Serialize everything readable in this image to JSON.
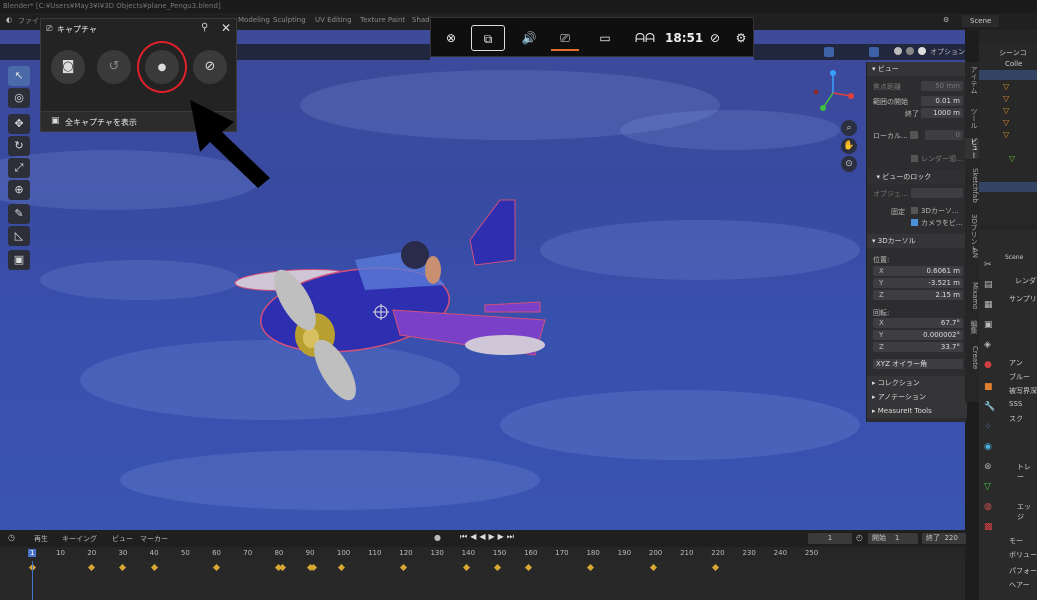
{
  "window": {
    "title": "Blender* [C:¥Users¥May3¥I¥3D Objects¥plane_Pengu3.blend]"
  },
  "topbar": {
    "file_menu": "ファイ",
    "workspaces": [
      "Modeling",
      "Sculpting",
      "UV Editing",
      "Texture Paint",
      "Shadi"
    ],
    "scene_label": "Scene",
    "options_label": "オプション"
  },
  "capture_widget": {
    "title": "キャプチャ",
    "show_all_label": "全キャプチャを表示",
    "screenshot_icon": "camera-icon",
    "record_last_icon": "history-icon",
    "record_icon": "record-dot-icon",
    "mic_icon": "mic-off-icon"
  },
  "gamebar": {
    "time": "18:51",
    "icons": [
      "xbox-icon",
      "widget-icon",
      "audio-icon",
      "capture-icon",
      "performance-icon",
      "social-icon",
      "mouse-icon",
      "settings-icon"
    ]
  },
  "npanel": {
    "view_header": "ビュー",
    "focal_label": "焦点距離",
    "focal_value": "50 mm",
    "clip_start_label": "範囲の開始",
    "clip_start_value": "0.01 m",
    "clip_end_label": "終了",
    "clip_end_value": "1000 m",
    "local_label": "ローカル...",
    "local_value": "0",
    "render_label": "レンダー領...",
    "view_lock_header": "ビューのロック",
    "object_label": "オブジェ...",
    "lock_label": "固定",
    "lock_cursor": "3Dカーソ...",
    "lock_camera": "カメラをビ...",
    "cursor_header": "3Dカーソル",
    "location_label": "位置:",
    "x_label": "X",
    "x_value": "0.6061 m",
    "y_label": "Y",
    "y_value": "-3.521 m",
    "z_label": "Z",
    "z_value": "2.15 m",
    "rotation_label": "回転:",
    "rx_value": "67.7°",
    "ry_value": "0.000002°",
    "rz_value": "33.7°",
    "rot_mode": "XYZ オイラー角",
    "collection_header": "コレクション",
    "annotation_header": "アノテーション",
    "measureit_header": "MeasureIt Tools"
  },
  "vtabs": [
    "アイテム",
    "ツール",
    "ビュー",
    "Sketchfab",
    "3Dプリント",
    "AN",
    "Mixamo",
    "編集",
    "Create"
  ],
  "outliner": {
    "scene_collection": "シーンコ",
    "collection": "Colle"
  },
  "properties": {
    "scene": "Scene",
    "render": "レンダ",
    "sampling": "サンプリ",
    "item1": "アン",
    "item2": "ブルー",
    "item3": "被写界深",
    "item4": "SSS",
    "item5": "スク",
    "trace": "トレー",
    "edge": "エッジ",
    "motion": "モー",
    "volume": "ボリュー",
    "perf": "パフォー",
    "hair": "ヘアー"
  },
  "timeline": {
    "playback": "再生",
    "keying": "キーイング",
    "view": "ビュー",
    "marker": "マーカー",
    "current_frame": "1",
    "start_label": "開始",
    "start_value": "1",
    "end_label": "終了",
    "end_value": "220",
    "ticks": [
      "1",
      "10",
      "20",
      "30",
      "40",
      "50",
      "60",
      "70",
      "80",
      "90",
      "100",
      "110",
      "120",
      "130",
      "140",
      "150",
      "160",
      "170",
      "180",
      "190",
      "200",
      "210",
      "220",
      "230",
      "240",
      "250"
    ],
    "keyframes": [
      1,
      20,
      30,
      40,
      60,
      80,
      81,
      90,
      91,
      100,
      120,
      140,
      150,
      160,
      180,
      200,
      220
    ]
  },
  "colors": {
    "record_highlight": "#e0202a",
    "accent": "#4a90d9",
    "keyframe": "#d8a834"
  }
}
